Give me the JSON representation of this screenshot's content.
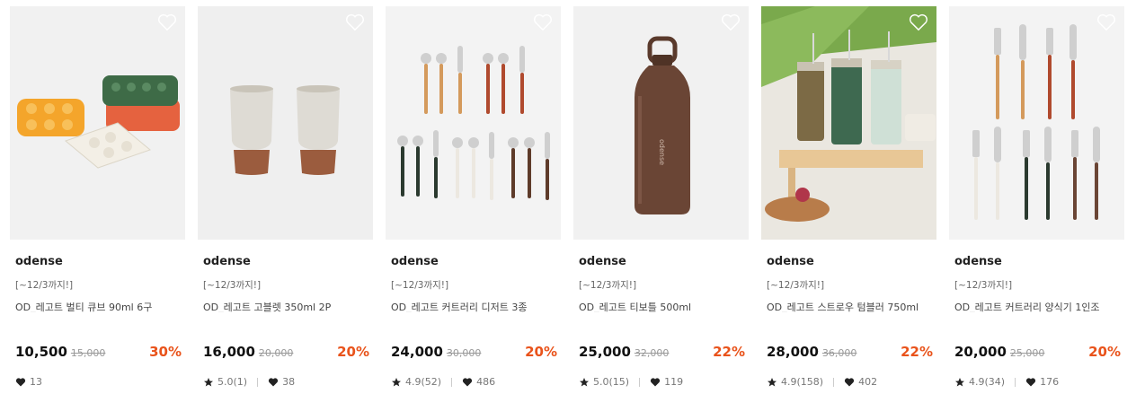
{
  "products": [
    {
      "brand": "odense",
      "promo": "[~12/3까지!]",
      "name": "OD_레고트 벌티 큐브 90ml 6구",
      "price": "10,500",
      "original_price": "15,000",
      "discount": "30%",
      "rating": "",
      "likes": "13",
      "image_icon": "ice-cube-tray"
    },
    {
      "brand": "odense",
      "promo": "[~12/3까지!]",
      "name": "OD_레고트 고블렛 350ml 2P",
      "price": "16,000",
      "original_price": "20,000",
      "discount": "20%",
      "rating": "5.0(1)",
      "likes": "38",
      "image_icon": "cup"
    },
    {
      "brand": "odense",
      "promo": "[~12/3까지!]",
      "name": "OD_레고트 커트러리 디저트 3종",
      "price": "24,000",
      "original_price": "30,000",
      "discount": "20%",
      "rating": "4.9(52)",
      "likes": "486",
      "image_icon": "cutlery"
    },
    {
      "brand": "odense",
      "promo": "[~12/3까지!]",
      "name": "OD_레고트 티보틀 500ml",
      "price": "25,000",
      "original_price": "32,000",
      "discount": "22%",
      "rating": "5.0(15)",
      "likes": "119",
      "image_icon": "bottle"
    },
    {
      "brand": "odense",
      "promo": "[~12/3까지!]",
      "name": "OD_레고트 스트로우 텀블러 750ml",
      "price": "28,000",
      "original_price": "36,000",
      "discount": "22%",
      "rating": "4.9(158)",
      "likes": "402",
      "image_icon": "tumbler"
    },
    {
      "brand": "odense",
      "promo": "[~12/3까지!]",
      "name": "OD_레고트 커트러리 양식기 1인조",
      "price": "20,000",
      "original_price": "25,000",
      "discount": "20%",
      "rating": "4.9(34)",
      "likes": "176",
      "image_icon": "cutlery"
    }
  ],
  "colors": {
    "discount": "#e9531b",
    "thumbnail_bg": "#f1f1f1"
  }
}
